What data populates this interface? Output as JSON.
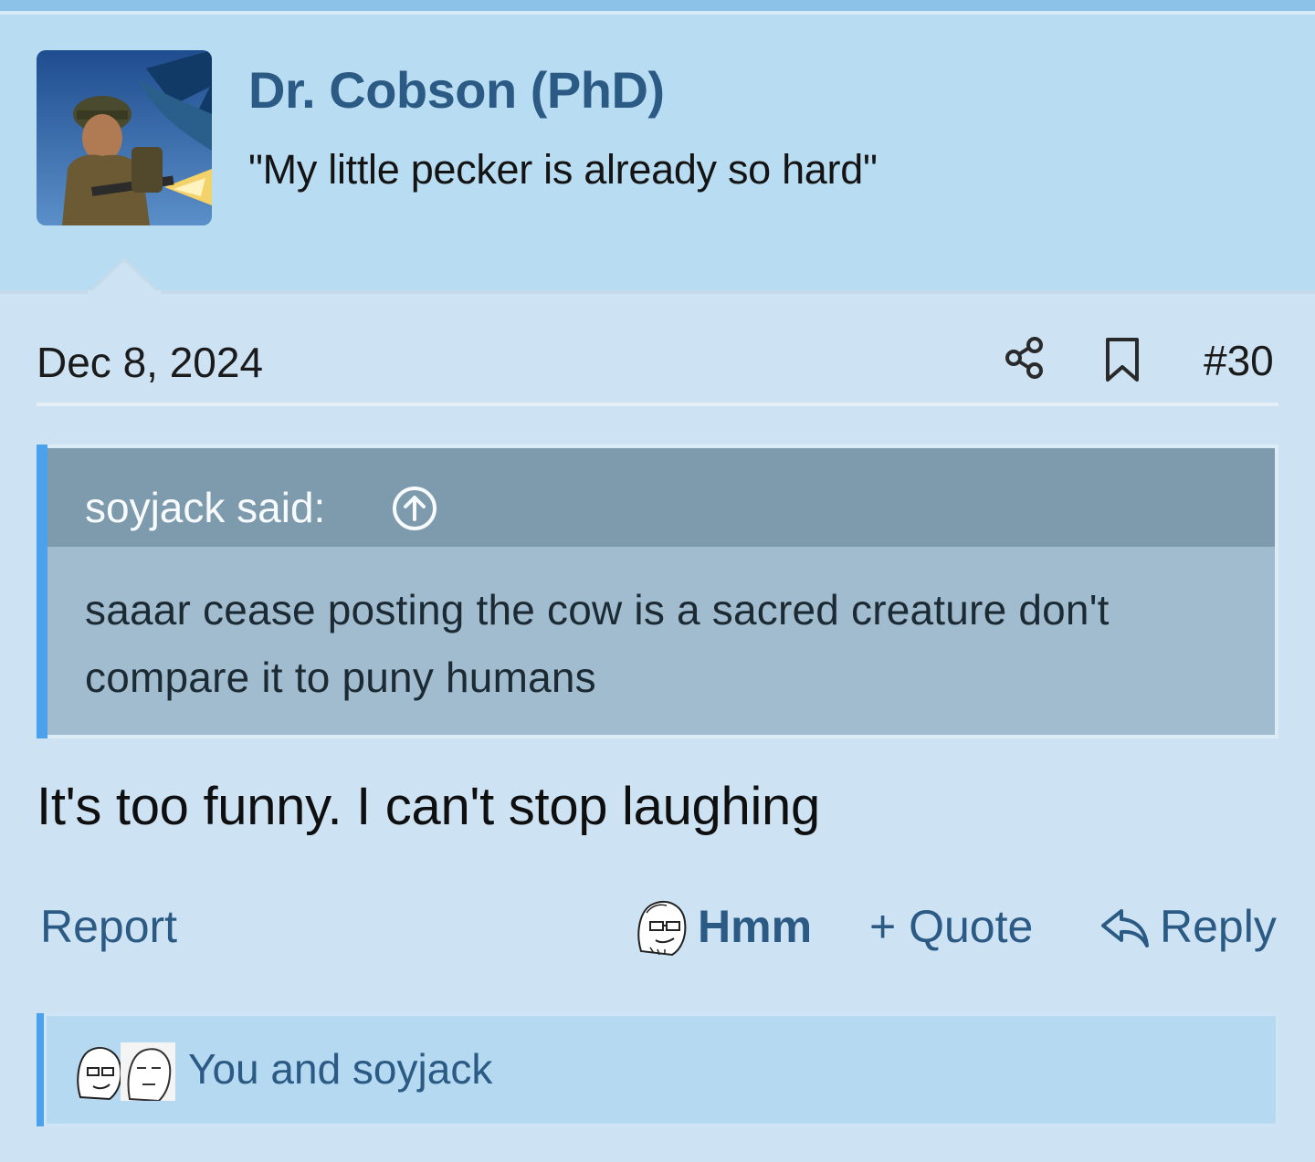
{
  "post": {
    "author": {
      "name": "Dr. Cobson (PhD)",
      "title": "\"My little pecker is already so hard\""
    },
    "date": "Dec 8, 2024",
    "number": "#30",
    "quote": {
      "author_label": "soyjack said:",
      "text": "saaar cease posting the cow is a sacred creature don't compare it to puny humans"
    },
    "message": "It's too funny. I can't stop laughing",
    "actions": {
      "report": "Report",
      "reaction": "Hmm",
      "quote": "+ Quote",
      "reply": "Reply"
    },
    "reactions_summary": "You and soyjack"
  },
  "icons": [
    "share-icon",
    "bookmark-icon",
    "arrow-up-circle-icon",
    "reply-arrow-icon",
    "soyjak-face-icon"
  ],
  "colors": {
    "accent": "#2b5a85",
    "header_bg": "#b8dcf1",
    "quote_bar": "#4ba1ec",
    "page_bg": "#cde3f3"
  }
}
